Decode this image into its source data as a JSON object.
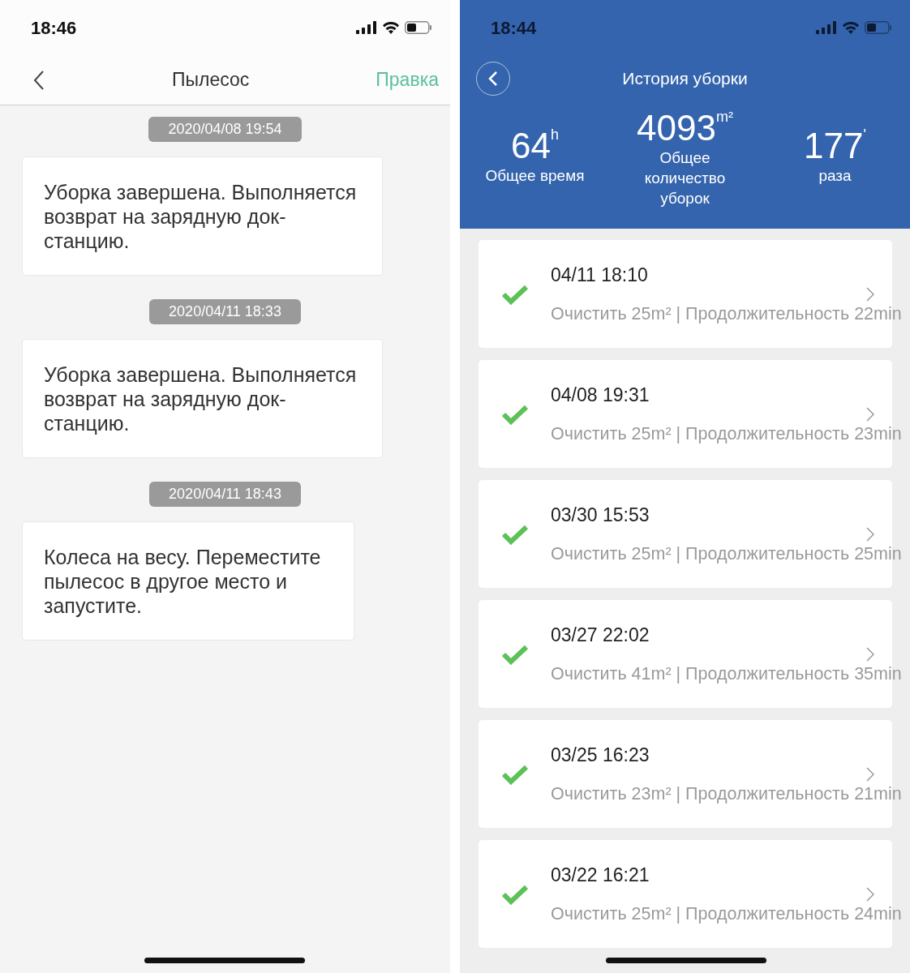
{
  "left_screen": {
    "status_bar": {
      "time": "18:46"
    },
    "nav": {
      "title": "Пылесос",
      "action": "Правка"
    },
    "messages": [
      {
        "timestamp": "2020/04/08 19:54",
        "text": "Уборка завершена. Выполняется возврат на зарядную док-станцию."
      },
      {
        "timestamp": "2020/04/11 18:33",
        "text": "Уборка завершена. Выполняется возврат на зарядную док-станцию."
      },
      {
        "timestamp": "2020/04/11 18:43",
        "text": "Колеса на весу. Переместите пылесос в другое место и запустите."
      }
    ]
  },
  "right_screen": {
    "status_bar": {
      "time": "18:44"
    },
    "title": "История уборки",
    "stats": [
      {
        "value": "64",
        "unit": "h",
        "label": "Общее время"
      },
      {
        "value": "4093",
        "unit": "m²",
        "label": "Общее количество уборок"
      },
      {
        "value": "177",
        "unit": "'",
        "label": "раза"
      }
    ],
    "records": [
      {
        "date": "04/11 18:10",
        "details": "Очистить 25m² | Продолжительность 22min",
        "completed": true
      },
      {
        "date": "04/08 19:31",
        "details": "Очистить 25m² | Продолжительность 23min",
        "completed": true
      },
      {
        "date": "03/30 15:53",
        "details": "Очистить 25m² | Продолжительность 25min",
        "completed": true
      },
      {
        "date": "03/27 22:02",
        "details": "Очистить 41m² | Продолжительность 35min",
        "completed": true
      },
      {
        "date": "03/25 16:23",
        "details": "Очистить 23m² | Продолжительность 21min",
        "completed": true
      },
      {
        "date": "03/22 16:21",
        "details": "Очистить 25m² | Продолжительность 24min",
        "completed": true
      }
    ]
  }
}
